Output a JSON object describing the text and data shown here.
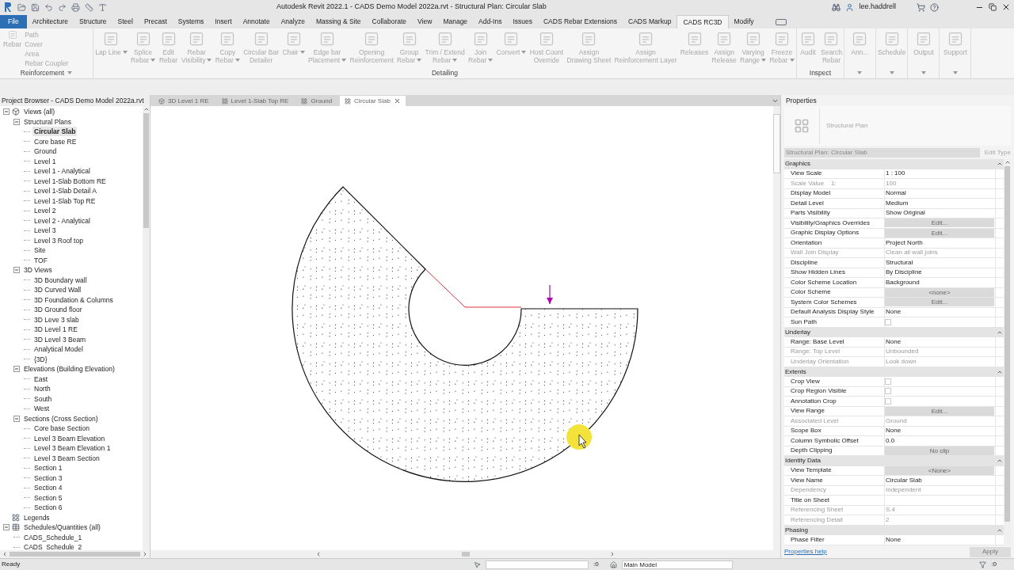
{
  "window": {
    "title": "Autodesk Revit 2022.1 - CADS Demo Model 2022a.rvt - Structural Plan: Circular Slab",
    "user": "lee.haddrell"
  },
  "menu_tabs": [
    {
      "label": "File",
      "kind": "file",
      "selected": false
    },
    {
      "label": "Architecture",
      "kind": "tab",
      "selected": false
    },
    {
      "label": "Structure",
      "kind": "tab",
      "selected": false
    },
    {
      "label": "Steel",
      "kind": "tab",
      "selected": false
    },
    {
      "label": "Precast",
      "kind": "tab",
      "selected": false
    },
    {
      "label": "Systems",
      "kind": "tab",
      "selected": false
    },
    {
      "label": "Insert",
      "kind": "tab",
      "selected": false
    },
    {
      "label": "Annotate",
      "kind": "tab",
      "selected": false
    },
    {
      "label": "Analyze",
      "kind": "tab",
      "selected": false
    },
    {
      "label": "Massing & Site",
      "kind": "tab",
      "selected": false
    },
    {
      "label": "Collaborate",
      "kind": "tab",
      "selected": false
    },
    {
      "label": "View",
      "kind": "tab",
      "selected": false
    },
    {
      "label": "Manage",
      "kind": "tab",
      "selected": false
    },
    {
      "label": "Add-Ins",
      "kind": "tab",
      "selected": false
    },
    {
      "label": "Issues",
      "kind": "tab",
      "selected": false
    },
    {
      "label": "CADS Rebar Extensions",
      "kind": "tab",
      "selected": false
    },
    {
      "label": "CADS Markup",
      "kind": "tab",
      "selected": false
    },
    {
      "label": "CADS RC3D",
      "kind": "tab",
      "selected": true
    },
    {
      "label": "Modify",
      "kind": "tab",
      "selected": false
    }
  ],
  "ribbon": {
    "reinforcement": {
      "label": "Reinforcement",
      "large": "Rebar",
      "small": [
        "Path",
        "Cover",
        "Area",
        "Rebar Coupler"
      ]
    },
    "panels": [
      {
        "label": "Detailing",
        "tools": [
          {
            "lines": [
              "Lap Line"
            ],
            "dropdown": true
          },
          {
            "lines": [
              "Splice",
              "Rebar"
            ],
            "dropdown": true
          },
          {
            "lines": [
              "Edit",
              "Rebar"
            ],
            "dropdown": false
          },
          {
            "lines": [
              "Rebar",
              "Visibility"
            ],
            "dropdown": true
          },
          {
            "lines": [
              "Copy",
              "Rebar"
            ],
            "dropdown": true
          },
          {
            "lines": [
              "Circular Bar",
              "Detailer"
            ],
            "dropdown": false
          },
          {
            "lines": [
              "Chair"
            ],
            "dropdown": true
          },
          {
            "lines": [
              "Edge bar",
              "Placement"
            ],
            "dropdown": true
          },
          {
            "lines": [
              "Opening",
              "Reinforcement"
            ],
            "dropdown": false
          },
          {
            "lines": [
              "Group",
              "Rebar"
            ],
            "dropdown": true
          },
          {
            "lines": [
              "Trim / Extend",
              "Rebar"
            ],
            "dropdown": true
          },
          {
            "lines": [
              "Join",
              "Rebar"
            ],
            "dropdown": true
          },
          {
            "lines": [
              "Convert"
            ],
            "dropdown": true
          },
          {
            "lines": [
              "Host Count",
              "Override"
            ],
            "dropdown": false
          },
          {
            "lines": [
              "Assign",
              "Drawing Sheet"
            ],
            "dropdown": false
          },
          {
            "lines": [
              "Assign",
              "Reinforcement Layer"
            ],
            "dropdown": false
          },
          {
            "lines": [
              "Releases"
            ],
            "dropdown": false
          },
          {
            "lines": [
              "Assign",
              "Release"
            ],
            "dropdown": false
          },
          {
            "lines": [
              "Varying",
              "Range"
            ],
            "dropdown": true
          },
          {
            "lines": [
              "Freeze",
              "Rebar"
            ],
            "dropdown": true
          }
        ]
      },
      {
        "label": "Inspect",
        "tools": [
          {
            "lines": [
              "Audit"
            ],
            "dropdown": false
          },
          {
            "lines": [
              "Search",
              "Rebar"
            ],
            "dropdown": false
          }
        ]
      },
      {
        "tools": [
          {
            "lines": [
              "Ann..."
            ],
            "dropdown": false
          }
        ],
        "panel_menu": true
      },
      {
        "tools": [
          {
            "lines": [
              "Schedule"
            ],
            "dropdown": false
          }
        ],
        "panel_menu": true
      },
      {
        "tools": [
          {
            "lines": [
              "Output"
            ],
            "dropdown": false
          }
        ],
        "panel_menu": true
      },
      {
        "tools": [
          {
            "lines": [
              "Support"
            ],
            "dropdown": false
          }
        ],
        "panel_menu": true
      }
    ]
  },
  "project_browser": {
    "title": "Project Browser - CADS Demo Model 2022a.rvt",
    "tree": [
      {
        "label": "Views (all)",
        "kind": "views",
        "selected": false,
        "expanded": true,
        "children": [
          {
            "label": "Structural Plans",
            "selected": false,
            "expanded": true,
            "children": [
              {
                "label": "Circular Slab",
                "selected": true
              },
              {
                "label": "Core base RE",
                "selected": false
              },
              {
                "label": "Ground",
                "selected": false
              },
              {
                "label": "Level 1",
                "selected": false
              },
              {
                "label": "Level 1 - Analytical",
                "selected": false
              },
              {
                "label": "Level 1-Slab Bottom RE",
                "selected": false
              },
              {
                "label": "Level 1-Slab Detail A",
                "selected": false
              },
              {
                "label": "Level 1-Slab Top RE",
                "selected": false
              },
              {
                "label": "Level 2",
                "selected": false
              },
              {
                "label": "Level 2 - Analytical",
                "selected": false
              },
              {
                "label": "Level 3",
                "selected": false
              },
              {
                "label": "Level 3 Roof top",
                "selected": false
              },
              {
                "label": "Site",
                "selected": false
              },
              {
                "label": "TOF",
                "selected": false
              }
            ]
          },
          {
            "label": "3D Views",
            "selected": false,
            "expanded": true,
            "children": [
              {
                "label": "3D Boundary wall",
                "selected": false
              },
              {
                "label": "3D Curved Wall",
                "selected": false
              },
              {
                "label": "3D Foundation & Columns",
                "selected": false
              },
              {
                "label": "3D Ground floor",
                "selected": false
              },
              {
                "label": "3D Leve 3 slab",
                "selected": false
              },
              {
                "label": "3D Level 1 RE",
                "selected": false
              },
              {
                "label": "3D Level 3 Beam",
                "selected": false
              },
              {
                "label": "Analytical Model",
                "selected": false
              },
              {
                "label": "{3D}",
                "selected": false
              }
            ]
          },
          {
            "label": "Elevations (Building Elevation)",
            "selected": false,
            "expanded": true,
            "children": [
              {
                "label": "East",
                "selected": false
              },
              {
                "label": "North",
                "selected": false
              },
              {
                "label": "South",
                "selected": false
              },
              {
                "label": "West",
                "selected": false
              }
            ]
          },
          {
            "label": "Sections (Cross Section)",
            "selected": false,
            "expanded": true,
            "children": [
              {
                "label": "Core base Section",
                "selected": false
              },
              {
                "label": "Level 3 Beam Elevation",
                "selected": false
              },
              {
                "label": "Level 3 Beam Elevation 1",
                "selected": false
              },
              {
                "label": "Level 3 Beam Section",
                "selected": false
              },
              {
                "label": "Section 1",
                "selected": false
              },
              {
                "label": "Section 3",
                "selected": false
              },
              {
                "label": "Section 4",
                "selected": false
              },
              {
                "label": "Section 5",
                "selected": false
              },
              {
                "label": "Section 6",
                "selected": false
              }
            ]
          }
        ]
      },
      {
        "label": "Legends",
        "kind": "legends",
        "selected": false
      },
      {
        "label": "Schedules/Quantities (all)",
        "kind": "schedules",
        "selected": false,
        "expanded": true,
        "children": [
          {
            "label": "CADS_Schedule_1",
            "selected": false
          },
          {
            "label": "CADS_Schedule_2",
            "selected": false
          }
        ]
      }
    ]
  },
  "view_tabs": [
    {
      "label": "3D Level 1 RE",
      "kind": "perspective",
      "selected": false
    },
    {
      "label": "Level 1-Slab Top RE",
      "kind": "plan",
      "selected": false
    },
    {
      "label": "Ground",
      "kind": "plan",
      "selected": false
    },
    {
      "label": "Circular Slab",
      "kind": "plan",
      "selected": true
    }
  ],
  "properties": {
    "title": "Properties",
    "type_name": "Structural Plan",
    "instance": "Structural Plan: Circular Slab",
    "edit_type": "Edit Type",
    "groups": [
      {
        "name": "Graphics",
        "rows": [
          {
            "name": "View Scale",
            "value": "1 : 100",
            "kind": "text",
            "disabled": false
          },
          {
            "name": "Scale Value    1:",
            "value": "100",
            "kind": "text",
            "disabled": true
          },
          {
            "name": "Display Model",
            "value": "Normal",
            "kind": "text",
            "disabled": false
          },
          {
            "name": "Detail Level",
            "value": "Medium",
            "kind": "text",
            "disabled": false
          },
          {
            "name": "Parts Visibility",
            "value": "Show Original",
            "kind": "text",
            "disabled": false
          },
          {
            "name": "Visibility/Graphics Overrides",
            "value": "Edit...",
            "kind": "button",
            "disabled": false
          },
          {
            "name": "Graphic Display Options",
            "value": "Edit...",
            "kind": "button",
            "disabled": false
          },
          {
            "name": "Orientation",
            "value": "Project North",
            "kind": "text",
            "disabled": false
          },
          {
            "name": "Wall Join Display",
            "value": "Clean all wall joins",
            "kind": "text",
            "disabled": true
          },
          {
            "name": "Discipline",
            "value": "Structural",
            "kind": "text",
            "disabled": false
          },
          {
            "name": "Show Hidden Lines",
            "value": "By Discipline",
            "kind": "text",
            "disabled": false
          },
          {
            "name": "Color Scheme Location",
            "value": "Background",
            "kind": "text",
            "disabled": false
          },
          {
            "name": "Color Scheme",
            "value": "<none>",
            "kind": "button",
            "disabled": false
          },
          {
            "name": "System Color Schemes",
            "value": "Edit...",
            "kind": "button",
            "disabled": false
          },
          {
            "name": "Default Analysis Display Style",
            "value": "None",
            "kind": "text",
            "disabled": false
          },
          {
            "name": "Sun Path",
            "kind": "checkbox",
            "checked": false,
            "disabled": false
          }
        ]
      },
      {
        "name": "Underlay",
        "rows": [
          {
            "name": "Range: Base Level",
            "value": "None",
            "kind": "text",
            "disabled": false
          },
          {
            "name": "Range: Top Level",
            "value": "Unbounded",
            "kind": "text",
            "disabled": true
          },
          {
            "name": "Underlay Orientation",
            "value": "Look down",
            "kind": "text",
            "disabled": true
          }
        ]
      },
      {
        "name": "Extents",
        "rows": [
          {
            "name": "Crop View",
            "kind": "checkbox",
            "checked": false,
            "disabled": false
          },
          {
            "name": "Crop Region Visible",
            "kind": "checkbox",
            "checked": false,
            "disabled": false
          },
          {
            "name": "Annotation Crop",
            "kind": "checkbox",
            "checked": false,
            "disabled": false
          },
          {
            "name": "View Range",
            "value": "Edit...",
            "kind": "button",
            "disabled": false
          },
          {
            "name": "Associated Level",
            "value": "Ground",
            "kind": "text",
            "disabled": true
          },
          {
            "name": "Scope Box",
            "value": "None",
            "kind": "text",
            "disabled": false
          },
          {
            "name": "Column Symbolic Offset",
            "value": "0.0",
            "kind": "text",
            "disabled": false
          },
          {
            "name": "Depth Clipping",
            "value": "No clip",
            "kind": "button",
            "disabled": false
          }
        ]
      },
      {
        "name": "Identity Data",
        "rows": [
          {
            "name": "View Template",
            "value": "<None>",
            "kind": "button",
            "disabled": false
          },
          {
            "name": "View Name",
            "value": "Circular Slab",
            "kind": "text",
            "disabled": false
          },
          {
            "name": "Dependency",
            "value": "Independent",
            "kind": "text",
            "disabled": true
          },
          {
            "name": "Title on Sheet",
            "kind": "text",
            "disabled": false
          },
          {
            "name": "Referencing Sheet",
            "value": "S.4",
            "kind": "text",
            "disabled": true
          },
          {
            "name": "Referencing Detail",
            "value": "2",
            "kind": "text",
            "disabled": true
          }
        ]
      },
      {
        "name": "Phasing",
        "rows": [
          {
            "name": "Phase Filter",
            "value": "None",
            "kind": "text",
            "disabled": false
          }
        ]
      }
    ],
    "help_link": "Properties help",
    "apply": "Apply"
  },
  "status_bar": {
    "status": "Ready",
    "workset_count": ":0",
    "model": "Main Model",
    "filter_count": ":0"
  }
}
